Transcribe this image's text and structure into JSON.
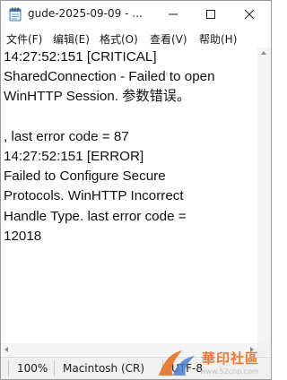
{
  "window": {
    "title": "gude-2025-09-09 - ..."
  },
  "menu": {
    "items": [
      "文件(F)",
      "编辑(E)",
      "格式(O)",
      "查看(V)",
      "帮助(H)"
    ]
  },
  "editor": {
    "content": "14:27:52:151 [CRITICAL]\nSharedConnection - Failed to open\nWinHTTP Session. 参数错误。\n\n, last error code = 87\n14:27:52:151 [ERROR]\nFailed to Configure Secure\nProtocols. WinHTTP Incorrect\nHandle Type. last error code =\n12018"
  },
  "status": {
    "zoom": "100%",
    "line_ending": "Macintosh (CR)",
    "encoding": "UTF-8"
  },
  "watermark": {
    "text": "華印社區",
    "url": "www.52cnp.com"
  },
  "icons": {
    "app": "notepad-icon",
    "minimize": "minimize-icon",
    "maximize": "maximize-icon",
    "close": "close-icon"
  }
}
